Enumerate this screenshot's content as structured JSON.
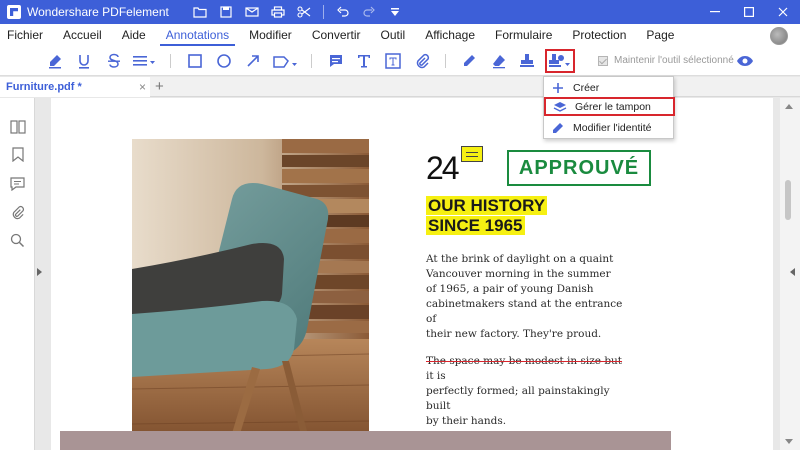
{
  "window": {
    "app_title": "Wondershare PDFelement",
    "brand_color": "#3d5fd8"
  },
  "menu": {
    "items": [
      {
        "label": "Fichier"
      },
      {
        "label": "Accueil"
      },
      {
        "label": "Aide"
      },
      {
        "label": "Annotations",
        "active": true
      },
      {
        "label": "Modifier"
      },
      {
        "label": "Convertir"
      },
      {
        "label": "Outil"
      },
      {
        "label": "Affichage"
      },
      {
        "label": "Formulaire"
      },
      {
        "label": "Protection"
      },
      {
        "label": "Page"
      }
    ]
  },
  "toolbar": {
    "keep_tool_label": "Maintenir l'outil sélectionné",
    "keep_tool_checked": true,
    "stamp_highlight_color": "#d8262d"
  },
  "tabs": {
    "active_tab": "Furniture.pdf *"
  },
  "stamp_menu": {
    "items": [
      {
        "label": "Créer",
        "icon": "plus-icon"
      },
      {
        "label": "Gérer le tampon",
        "icon": "layers-icon",
        "highlighted": true
      },
      {
        "label": "Modifier l'identité",
        "icon": "edit-identity-icon"
      }
    ]
  },
  "document": {
    "number": "24",
    "stamp_text": "APPROUVÉ",
    "stamp_color": "#1a8b3f",
    "headline_line1": "OUR HISTORY",
    "headline_line2": "SINCE 1965",
    "highlight_color": "#f6f012",
    "para1": [
      "At the brink of daylight on a quaint",
      "Vancouver morning in the summer",
      "of 1965, a pair of young Danish",
      "cabinetmakers stand at the entrance of",
      "their new factory. They're proud."
    ],
    "para2_struck": "The space may be modest in size but",
    "para2_rest_line1": " it is",
    "para2_lines": [
      "perfectly formed; all painstakingly built",
      "by their hands."
    ]
  }
}
